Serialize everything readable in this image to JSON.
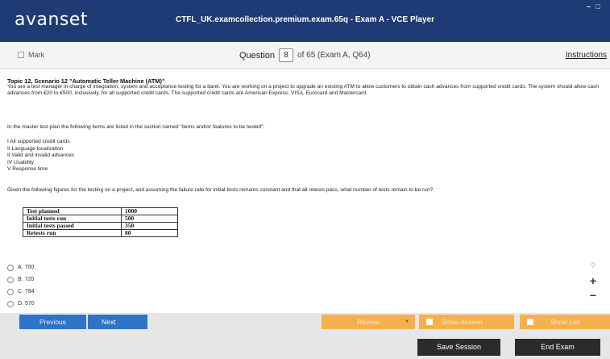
{
  "app": {
    "logo": "avanset",
    "window_title": "CTFL_UK.examcollection.premium.exam.65q - Exam A - VCE Player",
    "window_controls": "– □"
  },
  "question_bar": {
    "mark_label": "Mark",
    "question_label": "Question",
    "question_number": "8",
    "of_text": "of 65 (Exam A, Q64)",
    "instructions_label": "Instructions"
  },
  "question": {
    "topic": "Topic 12, Scenario 12 \"Automatic Teller Machine (ATM)\"",
    "paragraph1": "You are a test manager in charge of integration, system and acceptance testing for a bank. You are working on a project to upgrade an existing ATM to allow customers to obtain cash advances from supported credit cards. The system should allow cash advances from €20 to €500, inclusively, for all supported credit cards. The supported credit cards are American Express, VISA, Eurocard and Mastercard.",
    "paragraph2": "In the master test plan   the following items are listed in the section named \"items and/or features to be tested\":",
    "list_items": [
      "I All supported credit cards",
      "II Language localization",
      "II Valid and invalid advances",
      "IV Usability",
      "V Response time"
    ],
    "paragraph3": "Given the following figures for the testing on a project, and assuming the failure rate for initial tests remains constant and that all retests pass, what number of tests remain to be run?",
    "table": [
      {
        "label": "Test planned",
        "value": "1000"
      },
      {
        "label": "Initial tests run",
        "value": "500"
      },
      {
        "label": "Initial tests passed",
        "value": "350"
      },
      {
        "label": "Retests run",
        "value": "80"
      }
    ],
    "options": [
      {
        "letter": "A.",
        "value": "700"
      },
      {
        "letter": "B.",
        "value": "720"
      },
      {
        "letter": "C.",
        "value": "784"
      },
      {
        "letter": "D.",
        "value": "570"
      }
    ]
  },
  "side_tools": {
    "zoom": "⚲",
    "plus": "+",
    "minus": "−"
  },
  "nav": {
    "previous": "Previous",
    "next": "Next",
    "review": "Review",
    "review_caret": "▼",
    "show_answer": "Show Answer",
    "show_list": "Show List"
  },
  "footer": {
    "save_session": "Save Session",
    "end_exam": "End Exam"
  },
  "colors": {
    "title_bar": "#1f3b75",
    "primary_button": "#2e73c6",
    "orange_button": "#f4b04a",
    "dark_button": "#2b2b2b"
  }
}
